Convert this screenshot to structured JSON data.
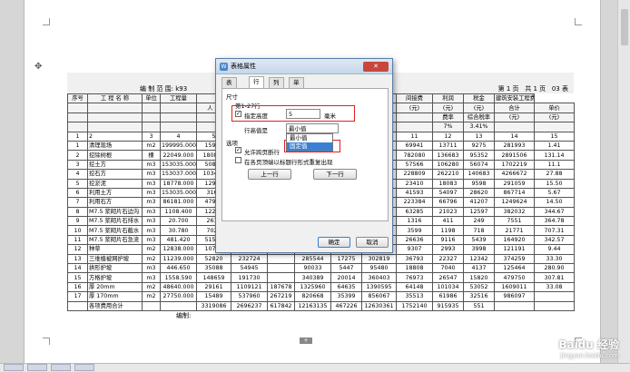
{
  "sheet": {
    "title": "建设项目名称: 衢",
    "subtitle_left": "编 制 范 围: k93",
    "page_info": [
      "第",
      "1",
      "页",
      "共",
      "1",
      "页",
      "03",
      "表"
    ],
    "header_top": [
      "序号",
      "工 程 名 称",
      "单位",
      "工程量",
      "",
      "",
      "",
      "",
      "",
      "",
      "间接费",
      "利润",
      "税金",
      "建筑安装工程费"
    ],
    "header_sub": [
      "",
      "",
      "",
      "",
      "人 工",
      "",
      "",
      "",
      "",
      "",
      "(元)",
      "(元)",
      "(元)",
      "合计",
      "单价"
    ],
    "header_rate": [
      "",
      "",
      "",
      "",
      "",
      "",
      "",
      "",
      "",
      "",
      "",
      "费率",
      "综合税率",
      "(元)",
      "(元)"
    ],
    "header_rate_vals": [
      "",
      "",
      "",
      "",
      "",
      "",
      "",
      "",
      "",
      "",
      "",
      "7%",
      "3.41%",
      "",
      ""
    ],
    "col_nums": [
      "1",
      "2",
      "3",
      "4",
      "5",
      "",
      "",
      "",
      "",
      "",
      "11",
      "12",
      "13",
      "14",
      "15"
    ],
    "rows": [
      [
        "1",
        "清理现场",
        "m2",
        "199995.000",
        "15964",
        "",
        "",
        "",
        "",
        "",
        "69941",
        "13711",
        "9275",
        "281993",
        "1.41"
      ],
      [
        "2",
        "挖除树根",
        "棵",
        "22049.000",
        "180805",
        "",
        "",
        "",
        "",
        "",
        "782080",
        "136683",
        "95352",
        "2891506",
        "131.14"
      ],
      [
        "3",
        "挖土方",
        "m3",
        "153035.000",
        "50815",
        "",
        "",
        "",
        "",
        "",
        "57566",
        "106280",
        "56074",
        "1702219",
        "11.1"
      ],
      [
        "4",
        "挖石方",
        "m3",
        "153037.000",
        "103465",
        "",
        "",
        "",
        "",
        "",
        "228809",
        "262210",
        "140683",
        "4266672",
        "27.88"
      ],
      [
        "5",
        "挖淤泥",
        "m3",
        "18778.000",
        "12940",
        "",
        "",
        "",
        "",
        "",
        "23410",
        "18083",
        "9598",
        "291059",
        "15.50"
      ],
      [
        "6",
        "利用土方",
        "m3",
        "153035.000",
        "3163",
        "",
        "",
        "",
        "",
        "",
        "41593",
        "54097",
        "28620",
        "867714",
        "5.67"
      ],
      [
        "7",
        "利用石方",
        "m3",
        "86181.000",
        "47929",
        "",
        "",
        "",
        "",
        "",
        "223384",
        "66796",
        "41207",
        "1249624",
        "14.50"
      ],
      [
        "8",
        "M7.5 浆砌片石边沟",
        "m3",
        "1108.400",
        "12298",
        "",
        "",
        "",
        "",
        "",
        "63285",
        "21023",
        "12597",
        "382032",
        "344.67"
      ],
      [
        "9",
        "M7.5 浆砌片石排水",
        "m3",
        "20.700",
        "2617",
        "",
        "",
        "",
        "",
        "",
        "1316",
        "411",
        "249",
        "7551",
        "364.78"
      ],
      [
        "10",
        "M7.5 浆砌片石截水",
        "m3",
        "30.780",
        "7028",
        "",
        "",
        "",
        "",
        "",
        "3599",
        "1198",
        "718",
        "21771",
        "707.31"
      ],
      [
        "11",
        "M7.5 浆砌片石急流",
        "m3",
        "481.420",
        "51516",
        "85310",
        "",
        "176605",
        "6904",
        "129730",
        "26636",
        "9116",
        "5439",
        "164920",
        "342.57"
      ],
      [
        "12",
        "种草",
        "m2",
        "12838.000",
        "10793",
        "76232",
        "8062",
        "95067",
        "5438",
        "100525",
        "9307",
        "2993",
        "3998",
        "121191",
        "9.44"
      ],
      [
        "13",
        "三维植被网护坡",
        "m2",
        "11239.000",
        "52820",
        "232724",
        "",
        "285544",
        "17275",
        "302819",
        "36793",
        "22327",
        "12342",
        "374259",
        "33.30"
      ],
      [
        "14",
        "拱形护坡",
        "m3",
        "446.650",
        "35088",
        "54945",
        "",
        "90033",
        "5447",
        "95480",
        "18808",
        "7040",
        "4137",
        "125464",
        "280.90"
      ],
      [
        "15",
        "方格护坡",
        "m3",
        "1558.590",
        "148659",
        "191730",
        "",
        "340389",
        "20014",
        "360403",
        "76973",
        "26547",
        "15820",
        "479750",
        "307.81"
      ],
      [
        "16",
        "厚 20mm",
        "m2",
        "48640.000",
        "29161",
        "1109121",
        "187678",
        "1325960",
        "64635",
        "1390595",
        "64148",
        "101034",
        "53052",
        "1609011",
        "33.08"
      ],
      [
        "17",
        "厚 170mm",
        "m2",
        "27750.000",
        "15489",
        "537960",
        "267219",
        "820668",
        "35399",
        "856067",
        "35513",
        "61986",
        "32516",
        "986097",
        ""
      ],
      [
        "",
        "各项费用合计",
        "",
        "",
        "3319086",
        "2696237",
        "617842",
        "12163135",
        "467226",
        "12630361",
        "1752140",
        "915935",
        "551",
        "",
        ""
      ]
    ],
    "footer": "编制:"
  },
  "dialog": {
    "title": "表格属性",
    "close_label": "✕",
    "tabs": [
      "表格",
      "行",
      "列",
      "单元格"
    ],
    "active_tab": 1,
    "size_label": "尺寸",
    "row_range": "第1-27行",
    "specify_height_label": "指定高度",
    "specify_height_checked": true,
    "height_value": "5",
    "height_unit": "毫米",
    "row_height_is_label": "行高值是",
    "row_height_value": "最小值",
    "dropdown_options": [
      "最小值",
      "固定值"
    ],
    "dropdown_selected": 0,
    "options_label": "选项",
    "allow_break_label": "允许跨页断行",
    "allow_break_checked": true,
    "repeat_header_label": "在各页顶端以标题行形式重复出现",
    "repeat_header_checked": false,
    "prev_row_label": "上一行",
    "next_row_label": "下一行",
    "ok_label": "确定",
    "cancel_label": "取消"
  },
  "watermark": {
    "main": "Baidu 经验",
    "sub": "jingyan.baidu.com"
  },
  "colors": {
    "highlight": "#e02020",
    "selection": "#3b7fd4"
  }
}
